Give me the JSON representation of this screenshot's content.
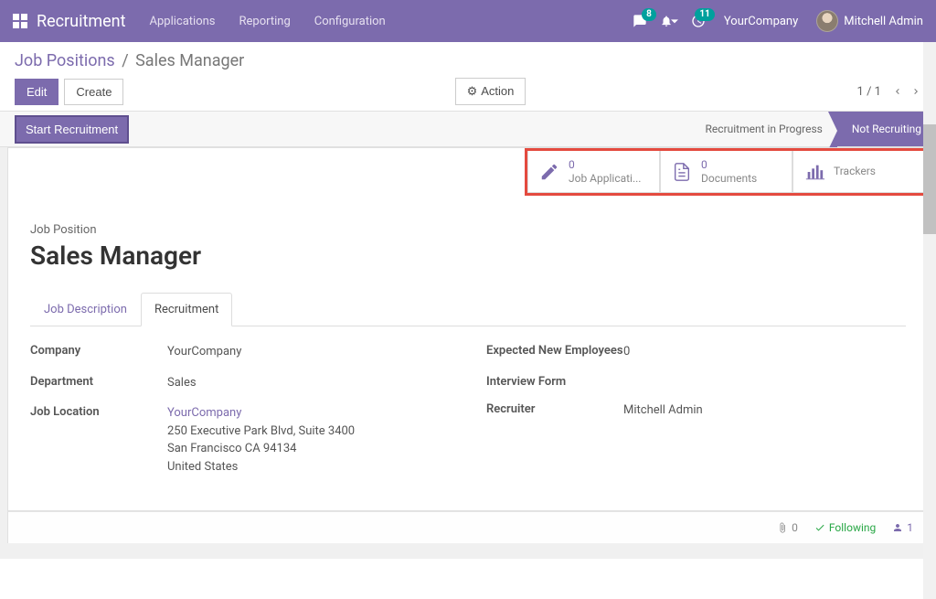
{
  "navbar": {
    "brand": "Recruitment",
    "links": [
      "Applications",
      "Reporting",
      "Configuration"
    ],
    "messages_badge": "8",
    "activities_badge": "11",
    "company": "YourCompany",
    "user": "Mitchell Admin"
  },
  "breadcrumb": {
    "parent": "Job Positions",
    "current": "Sales Manager"
  },
  "buttons": {
    "edit": "Edit",
    "create": "Create",
    "action": "Action",
    "start_recruitment": "Start Recruitment"
  },
  "pager": "1 / 1",
  "status": {
    "in_progress": "Recruitment in Progress",
    "not_recruiting": "Not Recruiting"
  },
  "stat_buttons": {
    "applications_count": "0",
    "applications_label": "Job Applicati...",
    "documents_count": "0",
    "documents_label": "Documents",
    "trackers_label": "Trackers"
  },
  "form": {
    "title_label": "Job Position",
    "title": "Sales Manager",
    "tabs": [
      "Job Description",
      "Recruitment"
    ],
    "left": {
      "company_label": "Company",
      "company": "YourCompany",
      "department_label": "Department",
      "department": "Sales",
      "location_label": "Job Location",
      "location_name": "YourCompany",
      "location_street": "250 Executive Park Blvd, Suite 3400",
      "location_city": "San Francisco CA 94134",
      "location_country": "United States"
    },
    "right": {
      "expected_label": "Expected New Employees",
      "expected_value": "0",
      "interview_label": "Interview Form",
      "recruiter_label": "Recruiter",
      "recruiter": "Mitchell Admin"
    }
  },
  "footer": {
    "attachments": "0",
    "following": "Following",
    "followers": "1"
  }
}
